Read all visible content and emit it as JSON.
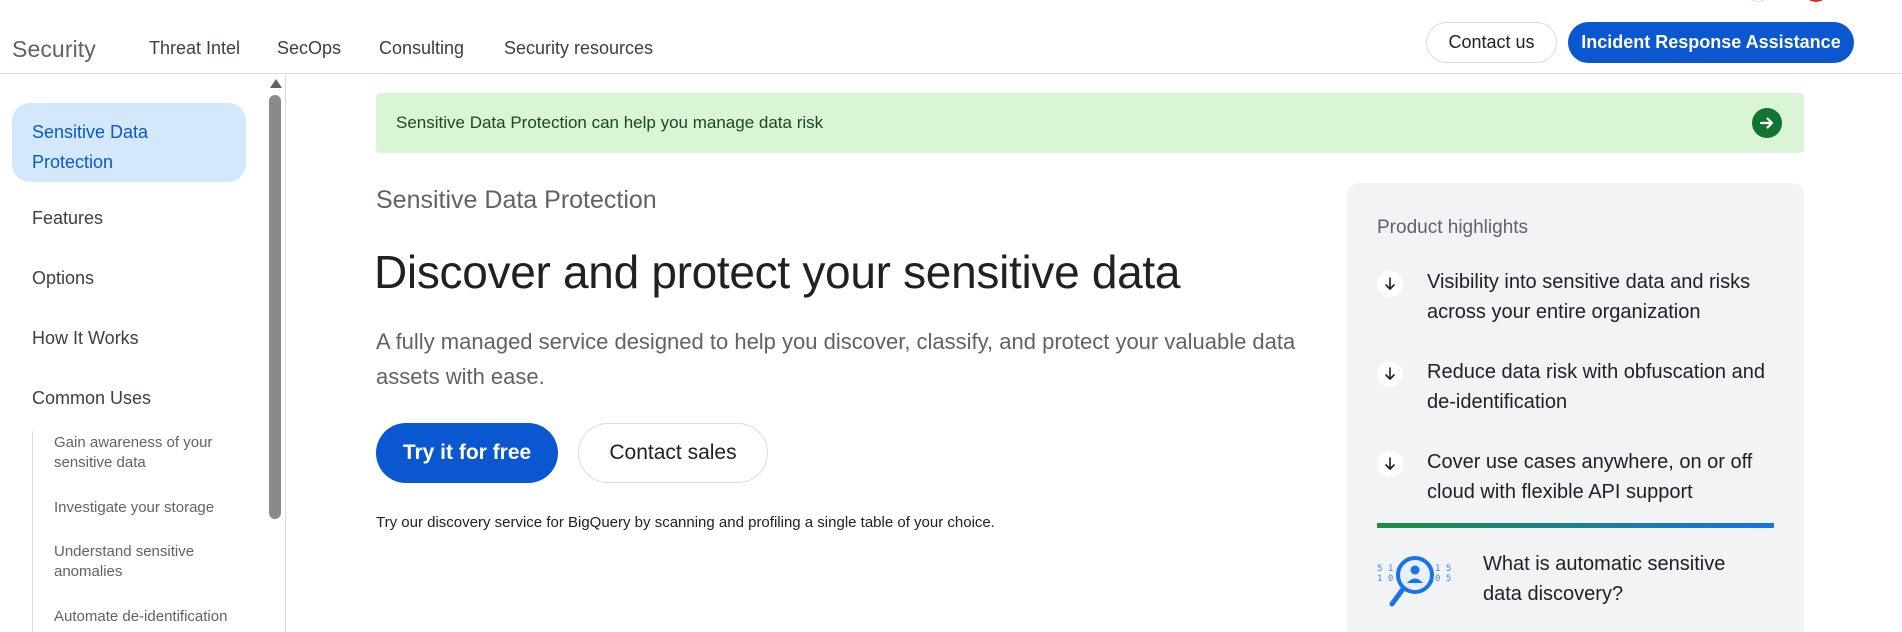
{
  "header": {
    "brand": "Security",
    "nav": [
      {
        "label": "Threat Intel"
      },
      {
        "label": "SecOps"
      },
      {
        "label": "Consulting"
      },
      {
        "label": "Security resources"
      }
    ],
    "contact_label": "Contact us",
    "incident_label": "Incident Response Assistance"
  },
  "sidebar": {
    "active_label": "Sensitive Data Protection",
    "items": [
      {
        "label": "Features"
      },
      {
        "label": "Options"
      },
      {
        "label": "How It Works"
      },
      {
        "label": "Common Uses"
      }
    ],
    "subitems": [
      {
        "label": "Gain awareness of your sensitive data"
      },
      {
        "label": "Investigate your storage"
      },
      {
        "label": "Understand sensitive anomalies"
      },
      {
        "label": "Automate de-identification"
      }
    ]
  },
  "banner": {
    "text": "Sensitive Data Protection can help you manage data risk"
  },
  "main": {
    "eyebrow": "Sensitive Data Protection",
    "title": "Discover and protect your sensitive data",
    "description": "A fully managed service designed to help you discover, classify, and protect your valuable data assets with ease.",
    "try_label": "Try it for free",
    "sales_label": "Contact sales",
    "note": "Try our discovery service for BigQuery by scanning and profiling a single table of your choice."
  },
  "highlights": {
    "heading": "Product highlights",
    "items": [
      {
        "text": "Visibility into sensitive data and risks across your entire organization"
      },
      {
        "text": "Reduce data risk with obfuscation and de-identification"
      },
      {
        "text": "Cover use cases anywhere, on or off cloud with flexible API support"
      }
    ],
    "video_title": "What is automatic sensitive data discovery?",
    "illustration_digits": {
      "left": "5 1\n1 0",
      "right": "1 5\n0 5"
    }
  },
  "colors": {
    "primary": "#0b57d0",
    "banner_bg": "#d9f5d6",
    "banner_arrow": "#137333",
    "active_nav_bg": "#d3e9fb",
    "card_bg": "#f1f3f4"
  }
}
